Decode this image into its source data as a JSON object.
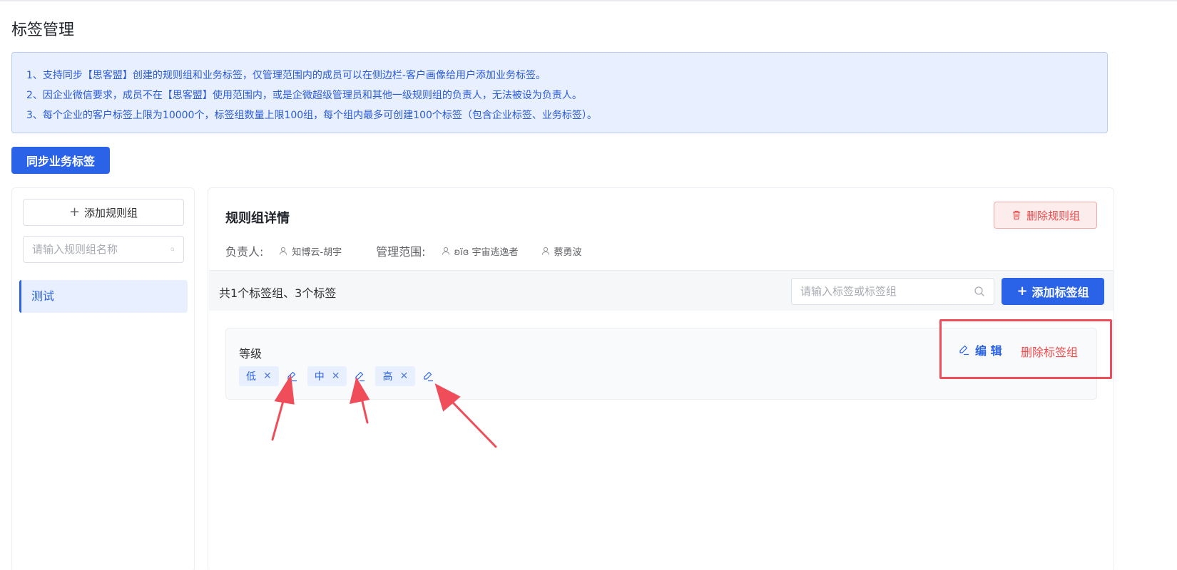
{
  "page": {
    "title": "标签管理"
  },
  "notice": {
    "lines": [
      "1、支持同步【思客盟】创建的规则组和业务标签，仅管理范围内的成员可以在侧边栏-客户画像给用户添加业务标签。",
      "2、因企业微信要求，成员不在【思客盟】使用范围内，或是企微超级管理员和其他一级规则组的负责人，无法被设为负责人。",
      "3、每个企业的客户标签上限为10000个，标签组数量上限100组，每个组内最多可创建100个标签（包含企业标签、业务标签）。"
    ]
  },
  "sync_button": {
    "label": "同步业务标签"
  },
  "sidebar": {
    "add_button_label": "添加规则组",
    "search_placeholder": "请输入规则组名称",
    "items": [
      {
        "label": "测试",
        "active": true
      }
    ]
  },
  "detail": {
    "title": "规则组详情",
    "delete_button_label": "删除规则组",
    "owner_label": "负责人:",
    "owner": "知博云-胡宇",
    "scope_label": "管理范围:",
    "scope_members": [
      "ʚïɞ 宇宙逃逸者",
      "蔡勇波"
    ],
    "count_text": "共1个标签组、3个标签",
    "tag_search_placeholder": "请输入标签或标签组",
    "add_tag_group_label": "添加标签组"
  },
  "tag_groups": [
    {
      "name": "等级",
      "edit_label": "编 辑",
      "delete_label": "删除标签组",
      "tags": [
        "低",
        "中",
        "高"
      ]
    }
  ],
  "colors": {
    "primary": "#2a62e8",
    "danger": "#f04b4b",
    "notice_bg": "#e8efff",
    "annotation": "#ef4d5a"
  },
  "icons": [
    "plus-icon",
    "search-icon",
    "trash-icon",
    "user-icon",
    "edit-icon",
    "close-icon"
  ]
}
